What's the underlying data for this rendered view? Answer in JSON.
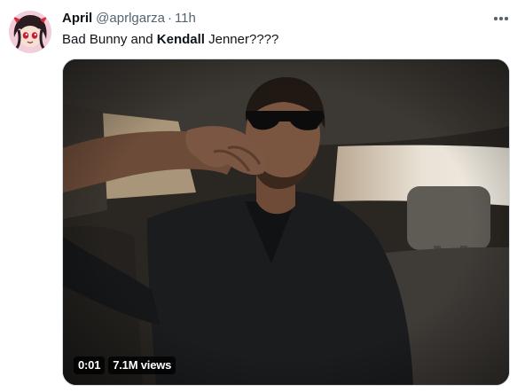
{
  "tweet": {
    "author_name": "April",
    "handle": "@aprlgarza",
    "separator": "·",
    "time": "11h",
    "text_parts": [
      "Bad Bunny and ",
      "Kendall",
      " Jenner????"
    ]
  },
  "media": {
    "type": "video",
    "duration": "0:01",
    "views": "7.1M views"
  },
  "icons": {
    "more": "more-horizontal-icon",
    "avatar": "cartoon-avatar"
  },
  "colors": {
    "text": "#0f1419",
    "secondary": "#536471",
    "media_border": "#cfd9de"
  }
}
